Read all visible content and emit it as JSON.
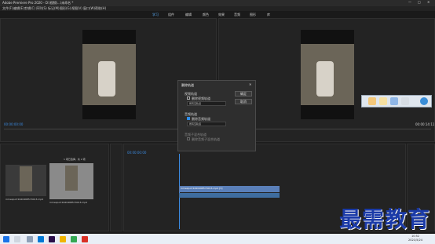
{
  "window": {
    "title": "Adobe Premiere Pro 2020 - D:\\视频\\...\\未命名 *"
  },
  "menu": [
    "文件(F)",
    "编辑(E)",
    "剪辑(C)",
    "序列(S)",
    "标记(M)",
    "图形(G)",
    "视图(V)",
    "窗口(W)",
    "帮助(H)"
  ],
  "workspaces": [
    "学习",
    "组件",
    "编辑",
    "颜色",
    "效果",
    "音频",
    "图形",
    "库"
  ],
  "source_monitor": {
    "timecode": "00:00:00:00"
  },
  "program_monitor": {
    "timecode": "00:00:00:00",
    "duration": "00:00:14:11"
  },
  "dialog": {
    "title": "删除轨道",
    "video_section": "视频轨道",
    "video_checkbox": "删除视频轨道",
    "video_dropdown": "所有空轨道",
    "audio_section": "音频轨道",
    "audio_checkbox": "删除音频轨道",
    "audio_dropdown": "所有空轨道",
    "submix_section": "音频子混合轨道",
    "submix_checkbox": "删除音频子混合轨道",
    "ok_label": "确定",
    "cancel_label": "取消"
  },
  "project_panel": {
    "item1": "mmexport1620468574013.mp4",
    "item2": "mmexport1620468574013.mp4",
    "info": "1 项已选择，共 2 项"
  },
  "timeline": {
    "timecode": "00:00:00:00",
    "clip_label": "mmexport1620468574013.mp4 [V]"
  },
  "watermark": "最需教育",
  "taskbar": {
    "time": "10:52",
    "date": "2021/5/24"
  }
}
